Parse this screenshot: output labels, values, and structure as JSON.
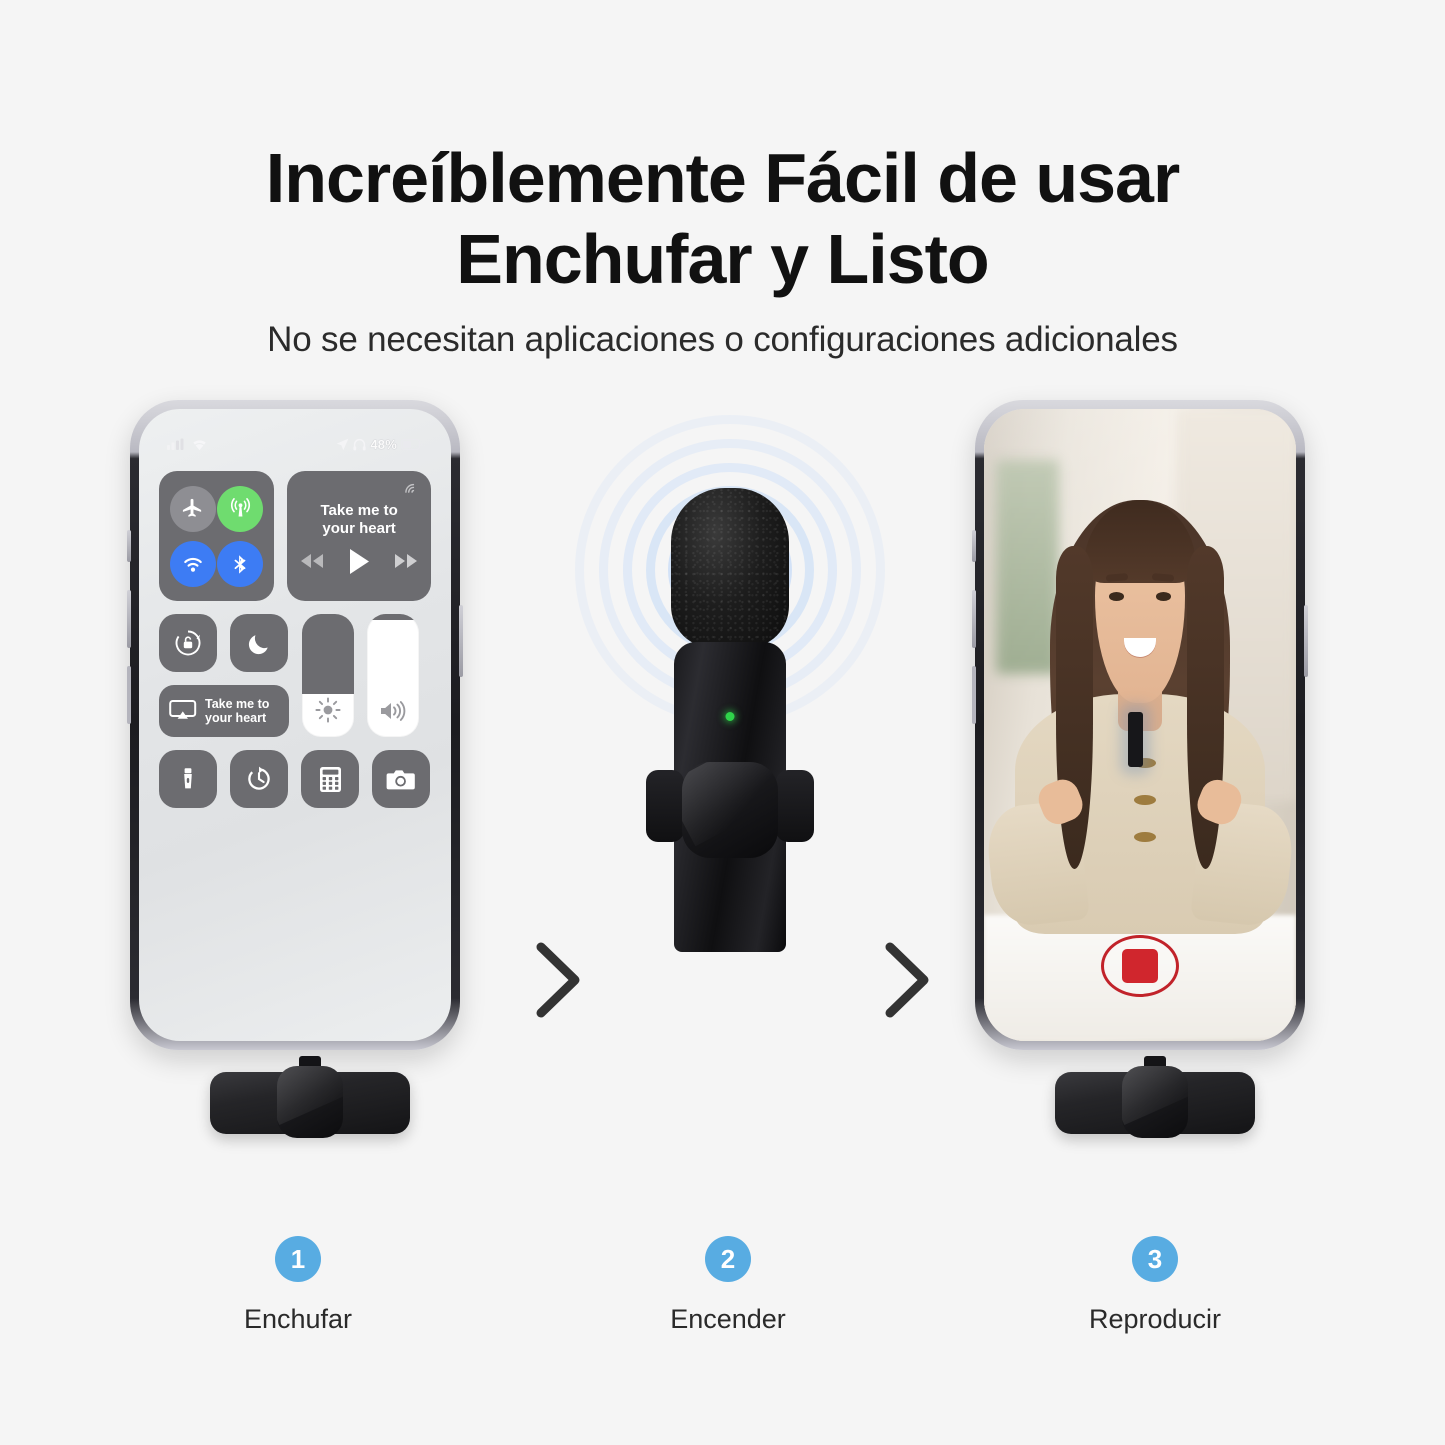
{
  "header": {
    "title_line1": "Increíblemente Fácil de usar",
    "title_line2": "Enchufar y Listo",
    "subtitle": "No se necesitan aplicaciones o configuraciones adicionales"
  },
  "colors": {
    "background": "#f5f5f5",
    "step_badge": "#58ace2",
    "record_red": "#d0262d",
    "led_green": "#2fd44a",
    "toggle_blue": "#3d7cf4",
    "cellular_green": "#6fdc6f",
    "tile_gray": "#6c6c70",
    "wave_blue": "#cfe0f7"
  },
  "phone_control_center": {
    "status_bar": {
      "signal_icon": "cellular-signal-icon",
      "wifi_icon": "wifi-icon",
      "location_icon": "location-arrow-icon",
      "headphones_icon": "headphones-icon",
      "battery_percent": "48%",
      "battery_icon": "battery-icon"
    },
    "connectivity": [
      {
        "name": "airplane-mode-toggle",
        "icon": "airplane-icon",
        "state": "off"
      },
      {
        "name": "cellular-data-toggle",
        "icon": "cellular-icon",
        "state": "on"
      },
      {
        "name": "wifi-toggle",
        "icon": "wifi-icon",
        "state": "on"
      },
      {
        "name": "bluetooth-toggle",
        "icon": "bluetooth-icon",
        "state": "on"
      }
    ],
    "media_widget": {
      "track_title_line1": "Take me to",
      "track_title_line2": "your heart",
      "airplay_icon": "airplay-audio-icon",
      "rewind_icon": "rewind-icon",
      "play_icon": "play-icon",
      "forward_icon": "fast-forward-icon"
    },
    "rotation_lock": {
      "icon": "rotation-lock-icon"
    },
    "do_not_disturb": {
      "icon": "moon-icon"
    },
    "screen_mirroring": {
      "icon": "screen-mirroring-icon",
      "label_line1": "Take me to",
      "label_line2": "your heart"
    },
    "brightness_slider": {
      "icon": "brightness-icon",
      "level": 35
    },
    "volume_slider": {
      "icon": "volume-icon",
      "level": 95
    },
    "shortcuts": [
      {
        "name": "flashlight-button",
        "icon": "flashlight-icon"
      },
      {
        "name": "timer-button",
        "icon": "timer-icon"
      },
      {
        "name": "calculator-button",
        "icon": "calculator-icon"
      },
      {
        "name": "camera-button",
        "icon": "camera-icon"
      }
    ]
  },
  "microphone": {
    "led_indicator": "power-led-on",
    "sound_waves": "sound-wave-rings"
  },
  "phone_video": {
    "record_button_icon": "stop-record-icon",
    "lavalier_mic": "clipped-lavalier-mic"
  },
  "separators": [
    {
      "name": "chevron-right-icon-1"
    },
    {
      "name": "chevron-right-icon-2"
    }
  ],
  "steps": [
    {
      "number": "1",
      "label": "Enchufar"
    },
    {
      "number": "2",
      "label": "Encender"
    },
    {
      "number": "3",
      "label": "Reproducir"
    }
  ]
}
